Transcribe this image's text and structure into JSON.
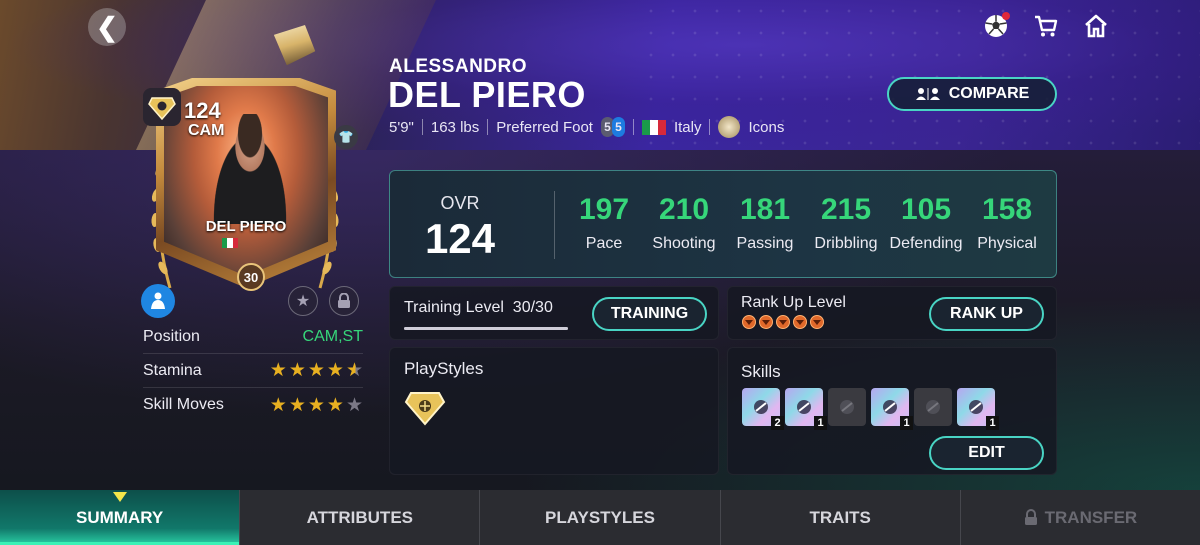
{
  "player": {
    "first_name": "ALESSANDRO",
    "last_name": "DEL PIERO",
    "height": "5'9\"",
    "weight": "163 lbs",
    "preferred_foot_label": "Preferred Foot",
    "foot_left": "5",
    "foot_right": "5",
    "nation": "Italy",
    "league": "Icons"
  },
  "header": {
    "compare_label": "COMPARE"
  },
  "card": {
    "ovr": "124",
    "position": "CAM",
    "name": "DEL PIERO",
    "level": "30"
  },
  "info": {
    "position_label": "Position",
    "position_value": "CAM,ST",
    "stamina_label": "Stamina",
    "stamina_stars": 4.5,
    "skill_moves_label": "Skill Moves",
    "skill_moves_stars": 4
  },
  "stats": {
    "ovr_label": "OVR",
    "ovr_value": "124",
    "items": [
      {
        "value": "197",
        "label": "Pace"
      },
      {
        "value": "210",
        "label": "Shooting"
      },
      {
        "value": "181",
        "label": "Passing"
      },
      {
        "value": "215",
        "label": "Dribbling"
      },
      {
        "value": "105",
        "label": "Defending"
      },
      {
        "value": "158",
        "label": "Physical"
      }
    ]
  },
  "training": {
    "label": "Training Level",
    "value": "30/30",
    "progress": 1.0,
    "button": "TRAINING"
  },
  "rank": {
    "label": "Rank Up Level",
    "dots": 5,
    "button": "RANK UP"
  },
  "playstyles": {
    "title": "PlayStyles"
  },
  "skills": {
    "title": "Skills",
    "items": [
      {
        "icon": "skill-dribble-icon",
        "count": "2",
        "active": true
      },
      {
        "icon": "skill-ball-icon",
        "count": "1",
        "active": true
      },
      {
        "icon": "skill-eye-icon",
        "count": "",
        "active": false
      },
      {
        "icon": "skill-kick-icon",
        "count": "1",
        "active": true
      },
      {
        "icon": "skill-shield-icon",
        "count": "",
        "active": false
      },
      {
        "icon": "skill-tackle-icon",
        "count": "1",
        "active": true
      }
    ],
    "edit_button": "EDIT"
  },
  "tabs": [
    {
      "label": "SUMMARY",
      "active": true
    },
    {
      "label": "ATTRIBUTES",
      "active": false
    },
    {
      "label": "PLAYSTYLES",
      "active": false
    },
    {
      "label": "TRAITS",
      "active": false
    },
    {
      "label": "TRANSFER",
      "active": false,
      "locked": true
    }
  ],
  "colors": {
    "accent_teal": "#49d4c4",
    "stat_green": "#36d67a",
    "star_gold": "#e8b021",
    "notification_red": "#e0283a"
  }
}
